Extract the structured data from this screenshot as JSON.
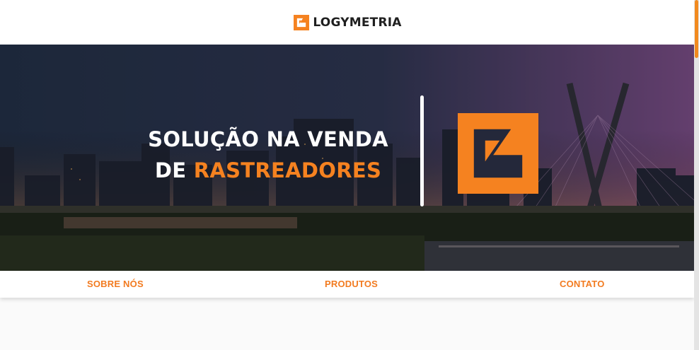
{
  "header": {
    "brand_name": "LOGYMETRIA"
  },
  "hero": {
    "title_line1": "SOLUÇÃO NA VENDA",
    "title_line2_prefix": "DE ",
    "title_line2_accent": "RASTREADORES"
  },
  "nav": {
    "items": [
      {
        "label": "SOBRE NÓS"
      },
      {
        "label": "PRODUTOS"
      },
      {
        "label": "CONTATO"
      }
    ]
  },
  "colors": {
    "accent": "#f58220",
    "accent_text": "#f27b20",
    "header_bg": "#ffffff",
    "brand_text": "#1f1f1f"
  }
}
